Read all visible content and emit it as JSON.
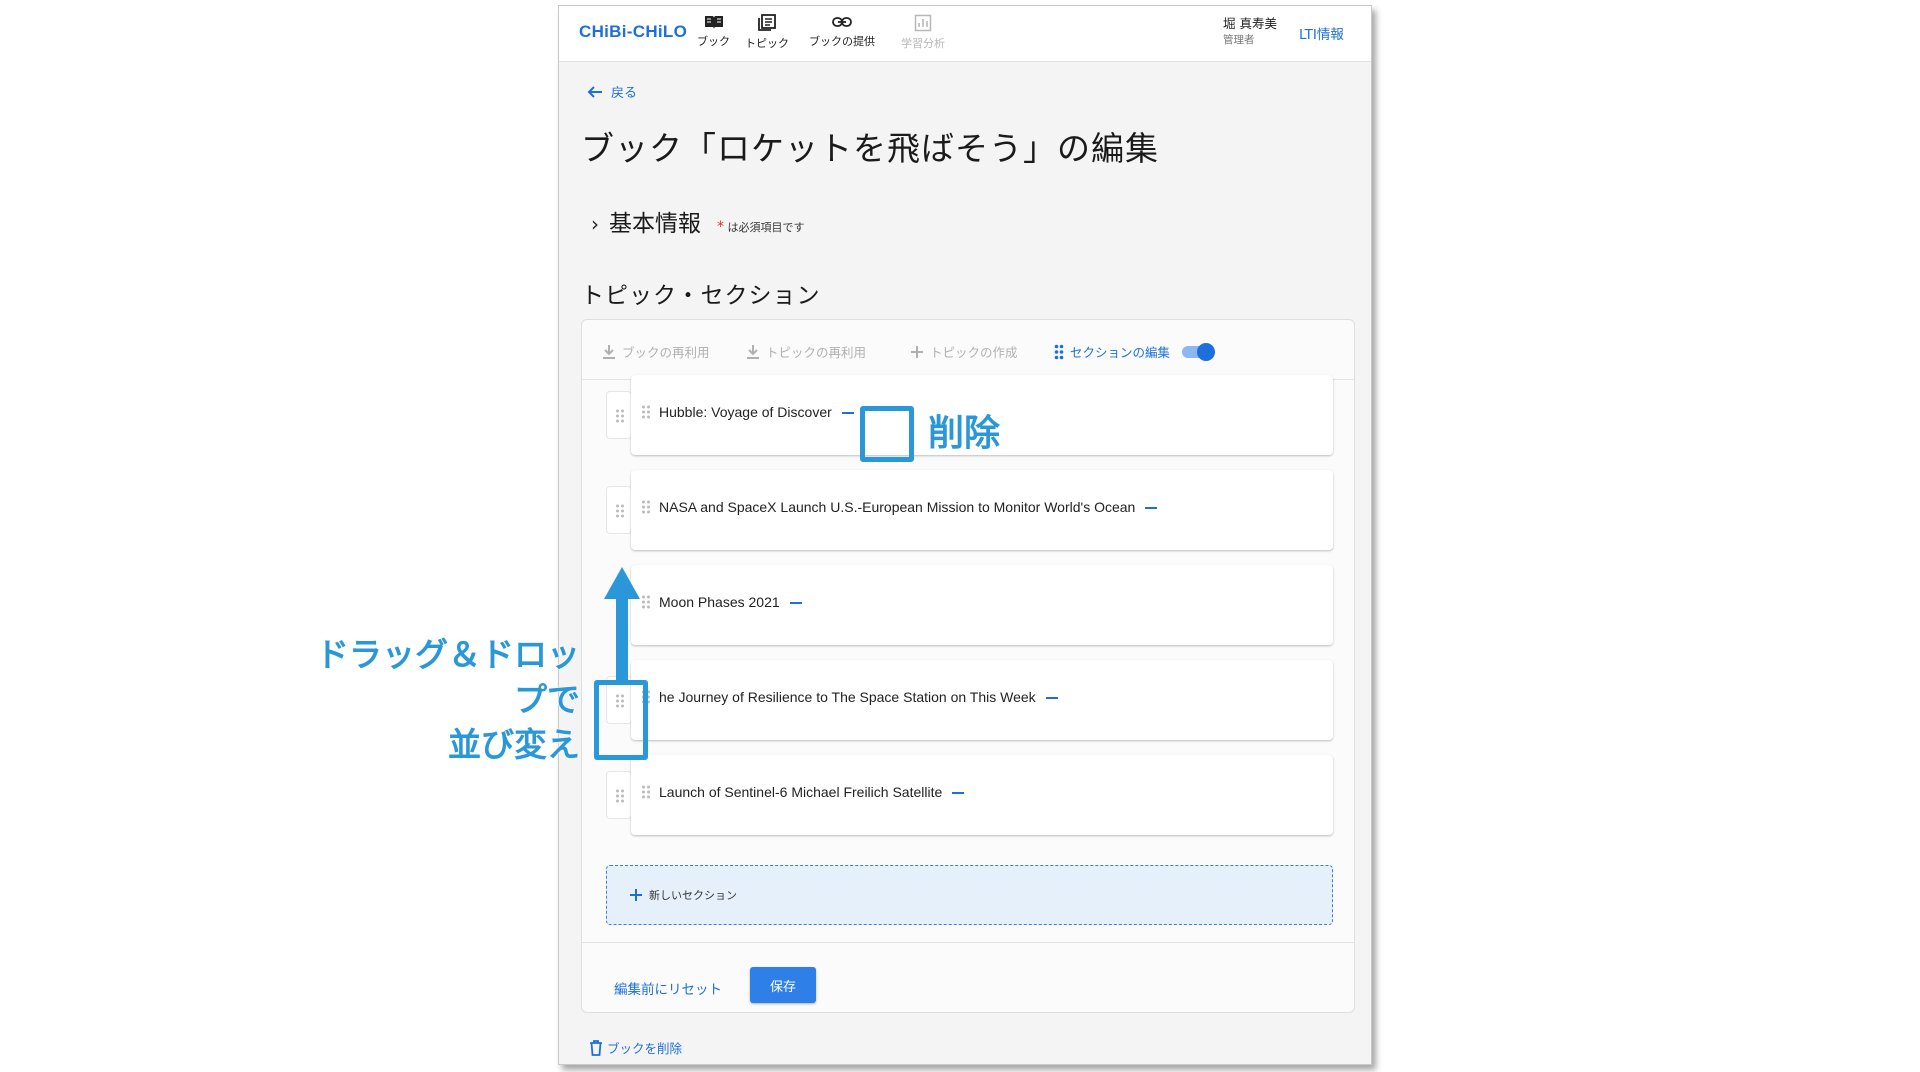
{
  "app": {
    "logo": "CHiBi-CHiLO",
    "nav": [
      {
        "label": "ブック",
        "icon": "book-icon"
      },
      {
        "label": "トピック",
        "icon": "topic-icon"
      },
      {
        "label": "ブックの提供",
        "icon": "link-icon"
      },
      {
        "label": "学習分析",
        "icon": "chart-icon",
        "disabled": true
      }
    ],
    "user": {
      "name": "堀 真寿美",
      "role": "管理者"
    },
    "lti": "LTI情報"
  },
  "page": {
    "back": "戻る",
    "title": "ブック「ロケットを飛ばそう」の編集",
    "basic_info": "基本情報",
    "required_note": "は必須項目です",
    "section_heading": "トピック・セクション"
  },
  "toolbar": {
    "reuse_book": "ブックの再利用",
    "reuse_topic": "トピックの再利用",
    "create_topic": "トピックの作成",
    "edit_sections": "セクションの編集"
  },
  "sections": [
    {
      "title": "Hubble: Voyage of Discover"
    },
    {
      "title": "NASA and SpaceX Launch U.S.-European Mission to Monitor World's Ocean"
    },
    {
      "title": "Moon Phases 2021"
    },
    {
      "title": "he Journey of Resilience to The Space Station on This Week"
    },
    {
      "title": "Launch of Sentinel-6 Michael Freilich Satellite"
    }
  ],
  "new_section": "新しいセクション",
  "actions": {
    "reset": "編集前にリセット",
    "save": "保存",
    "delete_book": "ブックを削除"
  },
  "annotations": {
    "delete": "削除",
    "drag_line1": "ドラッグ＆ドロップで",
    "drag_line2": "並び変え"
  },
  "colors": {
    "accent": "#1d6fdc",
    "annotation": "#2a98d8"
  }
}
